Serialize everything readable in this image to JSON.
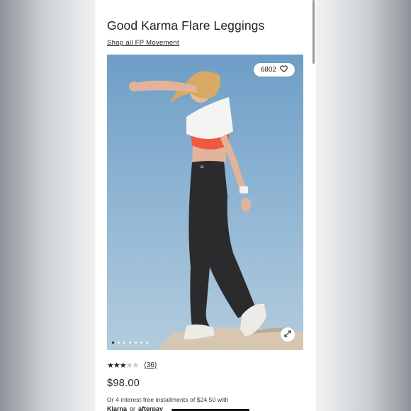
{
  "product": {
    "title": "Good Karma Flare Leggings",
    "shop_link": "Shop all FP Movement"
  },
  "gallery": {
    "likes_count": "6802",
    "image_count": 7,
    "active_index": 0,
    "icons": {
      "like": "heart-icon",
      "expand": "expand-icon"
    }
  },
  "rating": {
    "stars_filled": 3,
    "stars_total": 5,
    "review_count": "(36)"
  },
  "pricing": {
    "price": "$98.00",
    "installments_text": "Or 4 interest-free installments of $24.50 with",
    "klarna_label": "Klarna",
    "or_label": "or",
    "afterpay_label": "afterpay"
  },
  "colors": {
    "text": "#222222",
    "star_off": "#c8c8c8",
    "page_bg": "#ffffff"
  }
}
